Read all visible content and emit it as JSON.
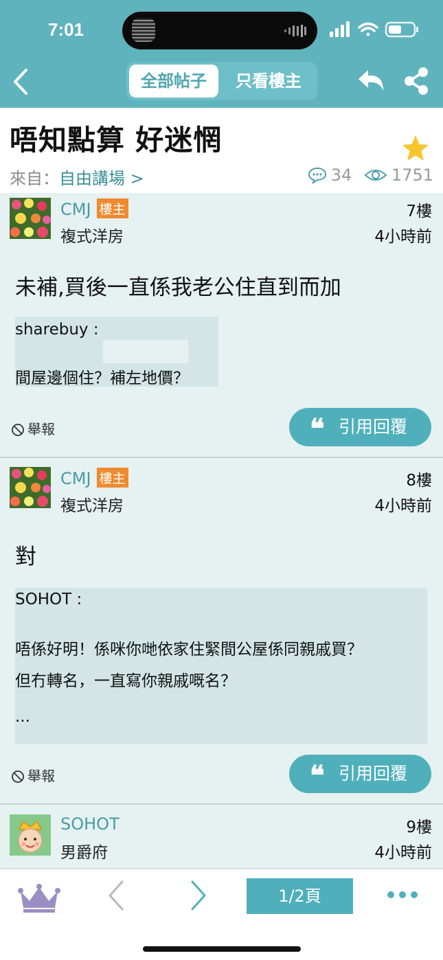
{
  "status": {
    "time": "7:01"
  },
  "tabs": {
    "all_posts": "全部帖子",
    "op_only": "只看樓主"
  },
  "thread": {
    "title": "唔知點算 好迷惘",
    "from_label": "來自：",
    "forum": "自由講場 >",
    "comments": "34",
    "views": "1751"
  },
  "posts": [
    {
      "author": "CMJ",
      "badge": "樓主",
      "rank": "複式洋房",
      "floor": "7樓",
      "time": "4小時前",
      "content": "未補,買後一直係我老公住直到而加",
      "quote": {
        "author": "sharebuy :",
        "lines": [
          "間屋邊個住？補左地價？"
        ]
      },
      "report": "舉報",
      "reply_button": "引用回覆"
    },
    {
      "author": "CMJ",
      "badge": "樓主",
      "rank": "複式洋房",
      "floor": "8樓",
      "time": "4小時前",
      "content": "對",
      "quote": {
        "author": "SOHOT :",
        "lines": [
          "唔係好明！係咪你哋依家住緊間公屋係同親戚買？",
          "但冇轉名，一直寫你親戚嘅名？",
          "..."
        ]
      },
      "report": "舉報",
      "reply_button": "引用回覆"
    },
    {
      "author": "SOHOT",
      "rank": "男爵府",
      "floor": "9樓",
      "time": "4小時前"
    }
  ],
  "bottom": {
    "page": "1/2頁"
  },
  "colors": {
    "header": "#5fb3bd",
    "accent": "#4fb0bb",
    "badge": "#ef8a2e",
    "post_bg": "#e6f1f1"
  }
}
